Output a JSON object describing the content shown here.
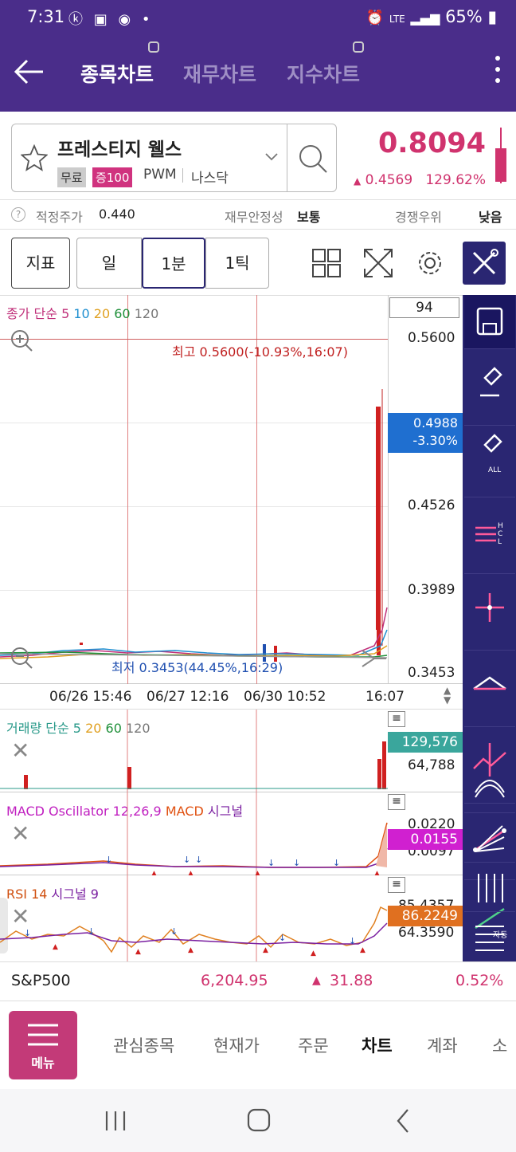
{
  "status": {
    "time": "7:31",
    "battery": "65%",
    "network": "LTE"
  },
  "header": {
    "tabs": [
      "종목차트",
      "재무차트",
      "지수차트"
    ]
  },
  "stock": {
    "name": "프레스티지 웰스",
    "tag_free": "무료",
    "tag_margin": "증100",
    "ticker": "PWM",
    "market": "나스닥",
    "price": "0.8094",
    "change": "0.4569",
    "change_pct": "129.62%"
  },
  "info": {
    "fair_price_label": "적정주가",
    "fair_price": "0.440",
    "stability_label": "재무안정성",
    "stability": "보통",
    "competition_label": "경쟁우위",
    "competition": "낮음"
  },
  "toolbar": {
    "indicator": "지표",
    "day": "일",
    "min": "1분",
    "tick": "1틱"
  },
  "main_chart": {
    "legend_prefix": "종가 단순",
    "ma": [
      "5",
      "10",
      "20",
      "60",
      "120"
    ],
    "count": "94",
    "high_label": "최고 0.5600(-10.93%,16:07)",
    "low_label": "최저 0.3453(44.45%,16:29)",
    "y_labels": [
      "0.5600",
      "0.4526",
      "0.3989",
      "0.3453"
    ],
    "current": "0.4988",
    "current_pct": "-3.30%",
    "x_labels": [
      "06/26 15:46",
      "06/27 12:16",
      "06/30 10:52",
      "16:07"
    ]
  },
  "volume_chart": {
    "legend_prefix": "거래량 단순",
    "ma": [
      "5",
      "20",
      "60",
      "120"
    ],
    "current": "129,576",
    "y_label": "64,788"
  },
  "macd_chart": {
    "label": "MACD Oscillator 12,26,9",
    "label2": "MACD",
    "label3": "시그널",
    "current": "0.0155",
    "y_label_1": "0.0220",
    "y_label_2": "0.0097"
  },
  "rsi_chart": {
    "label": "RSI 14",
    "label2": "시그널 9",
    "current": "86.2249",
    "y_label_1": "85.4357",
    "y_label_2": "64.3590"
  },
  "market": {
    "name": "S&P500",
    "value": "6,204.95",
    "change": "31.88",
    "change_pct": "0.52%"
  },
  "bottom_nav": {
    "menu": "메뉴",
    "items": [
      "관심종목",
      "현재가",
      "주문",
      "차트",
      "계좌",
      "소"
    ]
  },
  "colors": {
    "header": "#4a2d8a",
    "accent": "#d0336e",
    "blue": "#1f6fd0",
    "toolbar_side": "#2a2672"
  },
  "chart_data": [
    {
      "type": "line",
      "title": "",
      "note": "price chart; drawn from red candle at far right",
      "x": [
        "06/26 15:46",
        "06/27 12:16",
        "06/30 10:52",
        "16:07"
      ],
      "ylim": [
        0.3453,
        0.56
      ],
      "series": [
        {
          "name": "종가",
          "values": [
            0.3453,
            0.35,
            0.349,
            0.4988
          ]
        }
      ]
    },
    {
      "type": "bar",
      "title": "",
      "series": [
        {
          "name": "거래량",
          "values": [
            129576
          ]
        }
      ]
    }
  ]
}
